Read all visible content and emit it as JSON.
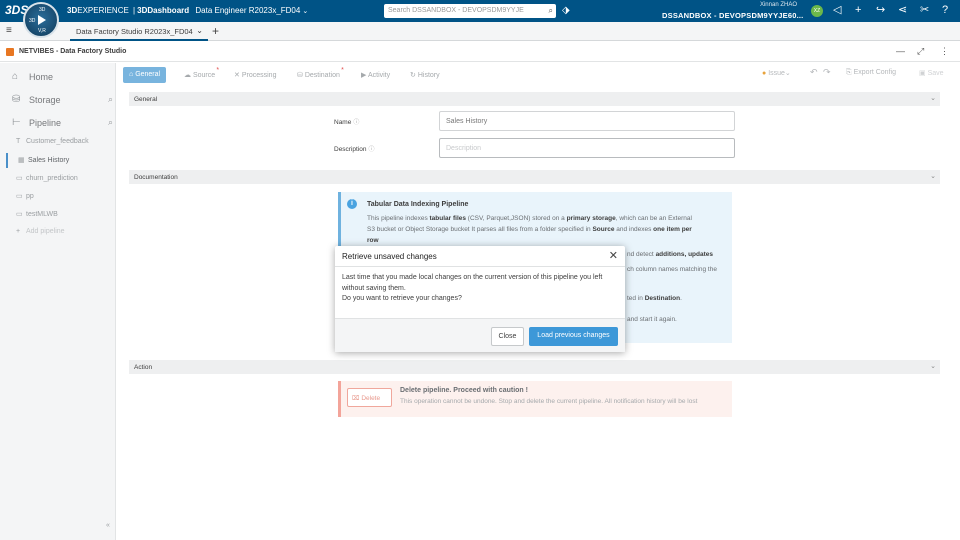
{
  "topbar": {
    "ds_logo": "3DS",
    "compass": {
      "n": "3D",
      "w": "3D",
      "s": "V,R"
    },
    "brand_strong": "3D",
    "brand_rest": "EXPERIENCE",
    "sep": "|",
    "app": "3DDashboard",
    "role": "Data Engineer R2023x_FD04",
    "search_placeholder": "Search DSSANDBOX - DEVOPSDM9YYJE",
    "user_name": "Xinnan ZHAO",
    "tenant": "DSSANDBOX - DEVOPSDM9YYJE60...",
    "avatar_initials": "XZ",
    "icons": [
      "tag-icon",
      "share-icon",
      "add-icon",
      "forward-icon",
      "network-icon",
      "tools-icon",
      "help-icon"
    ]
  },
  "tabbar": {
    "active_tab": "Data Factory Studio R2023x_FD04"
  },
  "widget": {
    "title": "NETVIBES - Data Factory Studio"
  },
  "sidebar": {
    "home": "Home",
    "storage": "Storage",
    "pipeline": "Pipeline",
    "items": [
      {
        "icon": "T",
        "label": "Customer_feedback"
      },
      {
        "icon": "▦",
        "label": "Sales History"
      },
      {
        "icon": "▭",
        "label": "churn_prediction"
      },
      {
        "icon": "▭",
        "label": "pp"
      },
      {
        "icon": "▭",
        "label": "testMLWB"
      },
      {
        "icon": "+",
        "label": "Add pipeline"
      }
    ],
    "collapse": "«"
  },
  "toolbar": {
    "tabs": [
      {
        "label": "General",
        "icon": "⌂"
      },
      {
        "label": "Source",
        "icon": "☁"
      },
      {
        "label": "Processing",
        "icon": "✕"
      },
      {
        "label": "Destination",
        "icon": "⛁"
      },
      {
        "label": "Activity",
        "icon": "▶"
      },
      {
        "label": "History",
        "icon": "↻"
      }
    ],
    "issue": "Issue",
    "undo": "↶",
    "redo": "↷",
    "export": "Export Config",
    "save": "Save"
  },
  "sections": {
    "general": "General",
    "documentation": "Documentation",
    "action": "Action"
  },
  "form": {
    "name_label": "Name",
    "name_value": "Sales History",
    "description_label": "Description",
    "description_placeholder": "Description"
  },
  "info": {
    "title": "Tabular Data Indexing Pipeline",
    "l1_pre": "This pipeline indexes ",
    "l1_b1": "tabular files",
    "l1_mid": " (CSV, Parquet,JSON) stored on a ",
    "l1_b2": "primary storage",
    "l1_post": ", which can be an External",
    "l2_pre": "S3 bucket or Object Storage bucket It parses all files from a folder specified in ",
    "l2_b": "Source",
    "l2_post": " and indexes ",
    "l2_b2": "one item per",
    "l3_b": "row",
    "l4_pre": "nd detect ",
    "l4_b": "additions, updates",
    "l5": "ch column names matching the",
    "l6_pre": "ted in ",
    "l6_b": "Destination",
    "l6_post": ".",
    "l7": "and start it again."
  },
  "danger": {
    "button": "Delete",
    "title": "Delete pipeline. Proceed with caution !",
    "text": "This operation cannot be undone. Stop and delete the current pipeline. All notification history will be lost"
  },
  "dialog": {
    "title": "Retrieve unsaved changes",
    "line1": "Last time that you made local changes on the current version of this pipeline you left",
    "line2": "without saving them.",
    "line3": "Do you want to retrieve your changes?",
    "close": "Close",
    "load": "Load previous changes"
  }
}
